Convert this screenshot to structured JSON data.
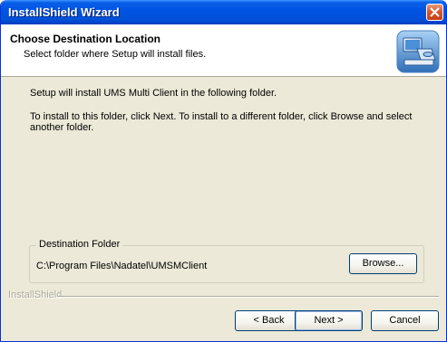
{
  "window": {
    "title": "InstallShield Wizard"
  },
  "header": {
    "title": "Choose Destination Location",
    "subtitle": "Select folder where Setup will install files.",
    "icon": "setup-computer-icon"
  },
  "content": {
    "line1": "Setup will install UMS Multi Client in the following folder.",
    "line2": "To install to this folder, click Next. To install to a different folder, click Browse and select another folder."
  },
  "destination": {
    "group_label": "Destination Folder",
    "path": "C:\\Program Files\\Nadatel\\UMSMClient",
    "browse_label": "Browse..."
  },
  "footer": {
    "brand": "InstallShield",
    "back_label": "< Back",
    "next_label": "Next >",
    "cancel_label": "Cancel"
  },
  "colors": {
    "titlebar": "#0054e3",
    "dialog_bg": "#ece9d8",
    "close_button": "#d7532c"
  }
}
